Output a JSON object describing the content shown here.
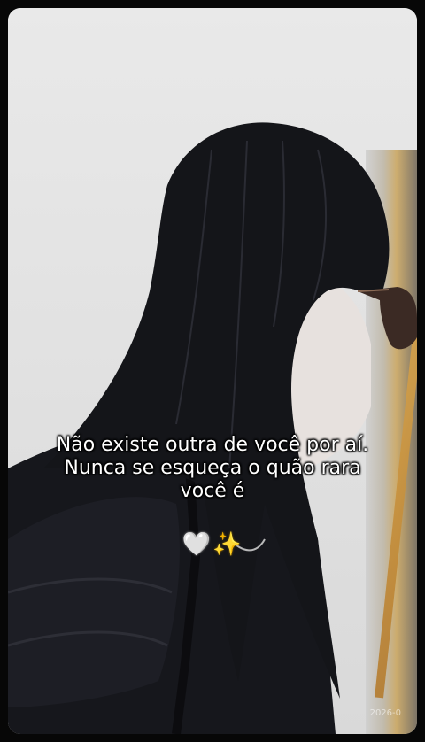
{
  "caption": {
    "line1": "Não existe outra de você por aí.",
    "line2": "Nunca se esqueça o quão rara",
    "line3": "você é"
  },
  "emojis": {
    "heart": "🤍",
    "sparkles": "✨"
  },
  "timestamp": "2026-0"
}
